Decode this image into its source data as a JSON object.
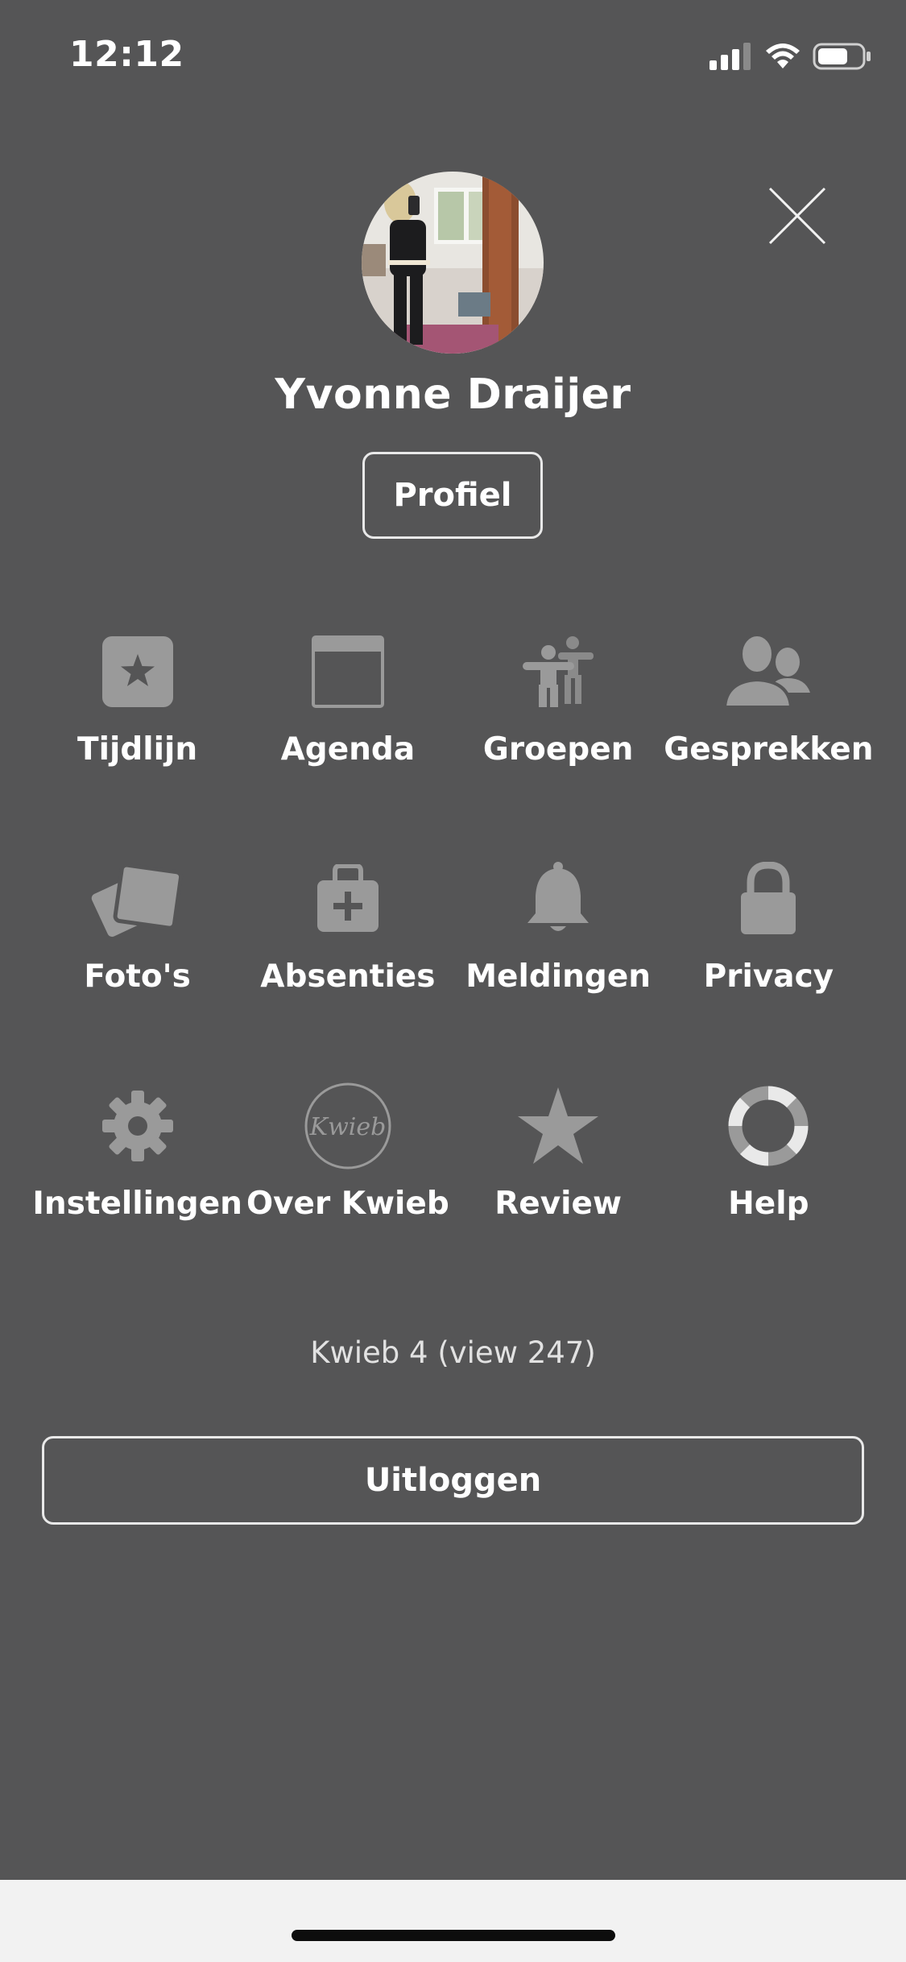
{
  "status_bar": {
    "time": "12:12"
  },
  "user": {
    "name": "Yvonne Draijer"
  },
  "profile_button_label": "Profiel",
  "menu": [
    {
      "label": "Tijdlijn",
      "icon": "timeline-star-icon"
    },
    {
      "label": "Agenda",
      "icon": "calendar-icon"
    },
    {
      "label": "Groepen",
      "icon": "groups-icon"
    },
    {
      "label": "Gesprekken",
      "icon": "conversations-icon"
    },
    {
      "label": "Foto's",
      "icon": "photos-icon"
    },
    {
      "label": "Absenties",
      "icon": "medical-kit-icon"
    },
    {
      "label": "Meldingen",
      "icon": "bell-icon"
    },
    {
      "label": "Privacy",
      "icon": "lock-icon"
    },
    {
      "label": "Instellingen",
      "icon": "gear-icon"
    },
    {
      "label": "Over Kwieb",
      "icon": "kwieb-logo-icon",
      "icon_text": "Kwieb"
    },
    {
      "label": "Review",
      "icon": "star-icon"
    },
    {
      "label": "Help",
      "icon": "lifebuoy-icon"
    }
  ],
  "version_text": "Kwieb 4 (view 247)",
  "logout_label": "Uitloggen",
  "colors": {
    "background": "#555556",
    "icon_gray": "#9a9a9a",
    "text": "#ffffff",
    "bottom_bar": "#f2f2f2"
  }
}
